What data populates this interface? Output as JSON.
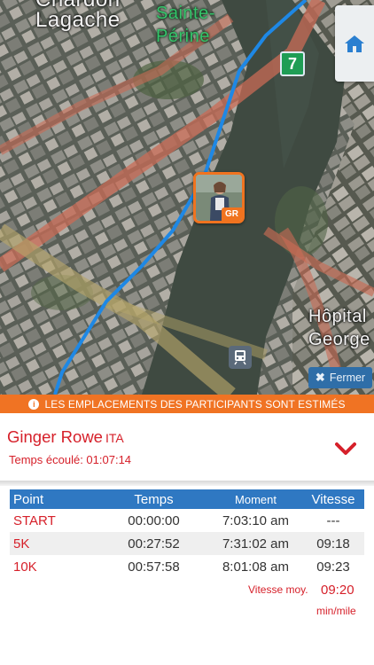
{
  "map": {
    "labels": {
      "chardon_lagache": "Chardon\nLagache",
      "sainte_perine": "Sainte-\nPérine",
      "hopital_george": "Hôpital\nGeorge"
    },
    "metro_badge": "7",
    "runner_initials": "GR",
    "close_label": "Fermer",
    "colors": {
      "route": "#1e88e5",
      "road": "#c96b55",
      "river": "#3f4a41",
      "marker_border": "#f0731f"
    },
    "icons": [
      "home-icon",
      "train-icon",
      "close-icon"
    ]
  },
  "notice": {
    "text": "LES EMPLACEMENTS DES PARTICIPANTS SONT ESTIMÉS",
    "icon": "info-icon"
  },
  "runner": {
    "name": "Ginger Rowe",
    "country": "ITA",
    "elapsed": "Temps écoulé: 01:07:14",
    "toggle_icon": "chevron-down-icon"
  },
  "splits": {
    "headers": {
      "point": "Point",
      "temps": "Temps",
      "moment": "Moment",
      "vitesse": "Vitesse"
    },
    "rows": [
      {
        "point": "START",
        "temps": "00:00:00",
        "moment": "7:03:10 am",
        "vitesse": "---"
      },
      {
        "point": "5K",
        "temps": "00:27:52",
        "moment": "7:31:02 am",
        "vitesse": "09:18"
      },
      {
        "point": "10K",
        "temps": "00:57:58",
        "moment": "8:01:08 am",
        "vitesse": "09:23"
      }
    ],
    "average": {
      "label": "Vitesse moy.",
      "value": "09:20",
      "unit": "min/mile"
    }
  },
  "theme": {
    "accent_red": "#d6202a",
    "accent_orange": "#f07323",
    "header_blue": "#2f78c2"
  }
}
